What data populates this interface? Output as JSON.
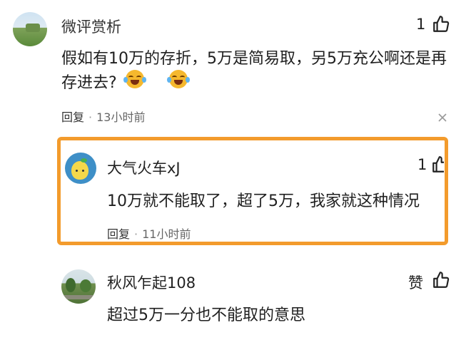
{
  "comments": [
    {
      "username": "微评赏析",
      "text_line1": "假如有10万的存折，5万是简易取，另5万充公啊还是再",
      "text_line2": "存进去?",
      "reply_label": "回复",
      "separator": "·",
      "time": "13小时前",
      "like_count": "1",
      "emojis": [
        "laughing-crying-emoji",
        "laughing-crying-emoji"
      ]
    },
    {
      "username": "大气火车xJ",
      "text": "10万就不能取了，超了5万，我家就这种情况",
      "reply_label": "回复",
      "separator": "·",
      "time": "11小时前",
      "like_count": "1",
      "highlighted": true
    },
    {
      "username": "秋风乍起108",
      "text": "超过5万一分也不能取的意思",
      "like_label": "赞"
    }
  ],
  "colors": {
    "highlight_border": "#f39b2c",
    "text": "#1f1f1f",
    "meta": "#666666"
  }
}
